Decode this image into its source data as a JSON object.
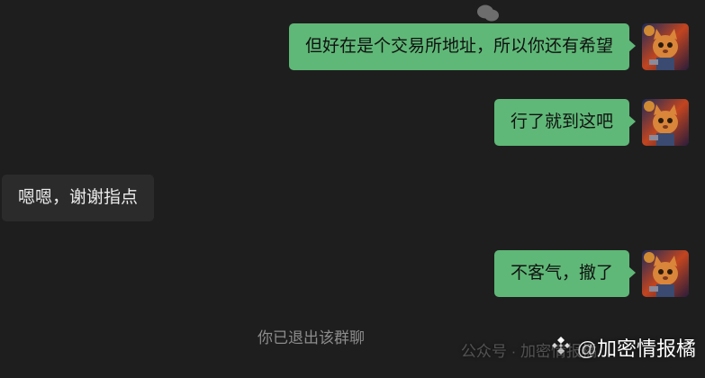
{
  "messages": [
    {
      "side": "right",
      "text": "但好在是个交易所地址，所以你还有希望"
    },
    {
      "side": "right",
      "text": "行了就到这吧"
    },
    {
      "side": "left",
      "text": "嗯嗯，谢谢指点"
    },
    {
      "side": "right",
      "text": "不客气，撤了"
    }
  ],
  "system_note": "你已退出该群聊",
  "watermark": {
    "faint_text": "公众号 · 加密情报橘",
    "main_text": "@加密情报橘"
  },
  "colors": {
    "background": "#1e1e1e",
    "bubble_right": "#5fb877",
    "bubble_left": "#2b2b2b"
  },
  "icons": [
    "avatar-cat-image",
    "wechat-icon",
    "binance-icon"
  ]
}
